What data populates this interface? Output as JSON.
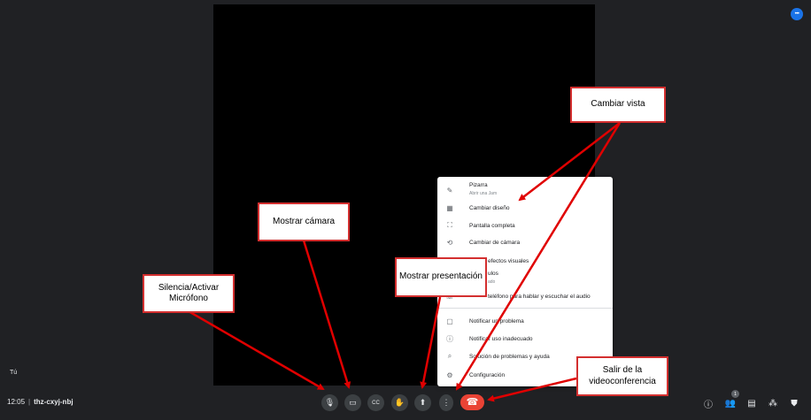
{
  "meeting": {
    "time": "12:05",
    "separator": "|",
    "code": "thz-cxyj-nbj",
    "self_label": "Tú",
    "top_button_icon": "more-horizontal-icon"
  },
  "toolbar": {
    "buttons": [
      {
        "name": "microphone-button",
        "icon": "microphone-icon",
        "glyph": "🎙"
      },
      {
        "name": "camera-button",
        "icon": "camera-icon",
        "glyph": "▭"
      },
      {
        "name": "captions-button",
        "icon": "captions-icon",
        "glyph": "CC"
      },
      {
        "name": "raise-hand-button",
        "icon": "hand-icon",
        "glyph": "✋"
      },
      {
        "name": "present-button",
        "icon": "present-screen-icon",
        "glyph": "⬆"
      },
      {
        "name": "more-options-button",
        "icon": "more-vertical-icon",
        "glyph": "⋮"
      },
      {
        "name": "leave-call-button",
        "icon": "hang-up-icon",
        "glyph": "☎"
      }
    ],
    "end_color": "#ea4335"
  },
  "side_controls": {
    "people_count": "1",
    "items": [
      {
        "name": "info-button",
        "icon": "info-icon",
        "glyph": "ⓘ"
      },
      {
        "name": "people-button",
        "icon": "people-icon",
        "glyph": "👥"
      },
      {
        "name": "chat-button",
        "icon": "chat-icon",
        "glyph": "▤"
      },
      {
        "name": "activities-button",
        "icon": "activities-icon",
        "glyph": "⁂"
      },
      {
        "name": "host-controls-button",
        "icon": "shield-icon",
        "glyph": "⛊"
      }
    ]
  },
  "menu": {
    "items": [
      {
        "icon": "pencil-icon",
        "glyph": "✎",
        "label": "Pizarra",
        "sub": "Abrir una Jam"
      },
      {
        "icon": "layout-icon",
        "glyph": "▦",
        "label": "Cambiar diseño",
        "sub": ""
      },
      {
        "icon": "fullscreen-icon",
        "glyph": "⛶",
        "label": "Pantalla completa",
        "sub": ""
      },
      {
        "icon": "switch-camera-icon",
        "glyph": "⟲",
        "label": "Cambiar de cámara",
        "sub": ""
      },
      {
        "icon": "visual-effects-icon",
        "glyph": "✦",
        "label": "efectos visuales",
        "sub": ""
      },
      {
        "icon": "subtitles-icon",
        "glyph": "▭",
        "label": "ulos",
        "sub": "ado"
      },
      {
        "icon": "phone-icon",
        "glyph": "☏",
        "label": "teléfono para hablar y escuchar el audio",
        "sub": ""
      },
      {
        "icon": "feedback-icon",
        "glyph": "▢",
        "label": "Notificar un problema",
        "sub": ""
      },
      {
        "icon": "report-icon",
        "glyph": "ⓘ",
        "label": "Notificar uso inadecuado",
        "sub": ""
      },
      {
        "icon": "troubleshoot-icon",
        "glyph": "⌕",
        "label": "Solución de problemas y ayuda",
        "sub": ""
      },
      {
        "icon": "settings-icon",
        "glyph": "⚙",
        "label": "Configuración",
        "sub": ""
      }
    ]
  },
  "annotations": {
    "cambiar_vista": "Cambiar vista",
    "mostrar_camara": "Mostrar cámara",
    "mostrar_presentacion": "Mostrar presentación",
    "silencia": "Silencia/Activar Micrófono",
    "salir": "Salir de la videoconferencia",
    "border_color": "#d32f2f",
    "arrow_color": "#e00000"
  }
}
